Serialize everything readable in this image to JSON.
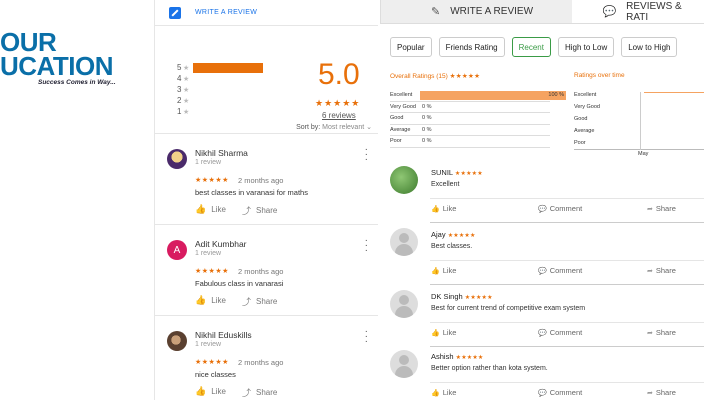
{
  "logo": {
    "line1": "OUR",
    "line2": "UCATION",
    "tagline": "Success Comes in Way..."
  },
  "google": {
    "write_review": "WRITE A REVIEW",
    "distribution": [
      {
        "stars": "5",
        "fraction": 1.0
      },
      {
        "stars": "4",
        "fraction": 0
      },
      {
        "stars": "3",
        "fraction": 0
      },
      {
        "stars": "2",
        "fraction": 0
      },
      {
        "stars": "1",
        "fraction": 0
      }
    ],
    "score": "5.0",
    "score_stars": "★★★★★",
    "review_count": "6 reviews",
    "sort_label": "Sort by:",
    "sort_value": "Most relevant",
    "reviews": [
      {
        "name": "Nikhil Sharma",
        "sub": "1 review",
        "stars": "★★★★★",
        "time": "2 months ago",
        "text": "best classes in varanasi for maths",
        "like": "Like",
        "share": "Share",
        "avatar_color": "#c8a26a"
      },
      {
        "name": "Adit Kumbhar",
        "sub": "1 review",
        "stars": "★★★★★",
        "time": "2 months ago",
        "text": "Fabulous class in vanarasi",
        "like": "Like",
        "share": "Share",
        "avatar_letter": "A",
        "avatar_color": "#d81b60"
      },
      {
        "name": "Nikhil Eduskills",
        "sub": "1 review",
        "stars": "★★★★★",
        "time": "2 months ago",
        "text": "nice classes",
        "like": "Like",
        "share": "Share",
        "avatar_color": "#7a5a42"
      }
    ]
  },
  "right": {
    "tab_write": "WRITE A REVIEW",
    "tab_reviews": "REVIEWS & RATI",
    "filters": [
      "Popular",
      "Friends Rating",
      "Recent",
      "High to Low",
      "Low to High"
    ],
    "active_filter": "Recent",
    "overall_title": "Overall Ratings (15)",
    "overall_stars": "★★★★★",
    "overall_rows": [
      {
        "label": "Excellent",
        "pct": "100 %",
        "fraction": 1.0
      },
      {
        "label": "Very Good",
        "pct": "0 %"
      },
      {
        "label": "Good",
        "pct": "0 %"
      },
      {
        "label": "Average",
        "pct": "0 %"
      },
      {
        "label": "Poor",
        "pct": "0 %"
      }
    ],
    "time_title": "Ratings over time",
    "time_labels": [
      "Excellent",
      "Very Good",
      "Good",
      "Average",
      "Poor"
    ],
    "time_x": "May",
    "reviews": [
      {
        "name": "SUNIL",
        "stars": "★★★★★",
        "text": "Excellent",
        "like": "Like",
        "comment": "Comment",
        "share": "Share",
        "avatar": "green"
      },
      {
        "name": "Ajay",
        "stars": "★★★★★",
        "text": "Best classes.",
        "like": "Like",
        "comment": "Comment",
        "share": "Share",
        "avatar": "user"
      },
      {
        "name": "DK Singh",
        "stars": "★★★★★",
        "text": "Best for current trend of competitive exam system",
        "like": "Like",
        "comment": "Comment",
        "share": "Share",
        "avatar": "user"
      },
      {
        "name": "Ashish",
        "stars": "★★★★★",
        "text": "Better option rather than kota system.",
        "like": "Like",
        "comment": "Comment",
        "share": "Share",
        "avatar": "user"
      }
    ]
  }
}
